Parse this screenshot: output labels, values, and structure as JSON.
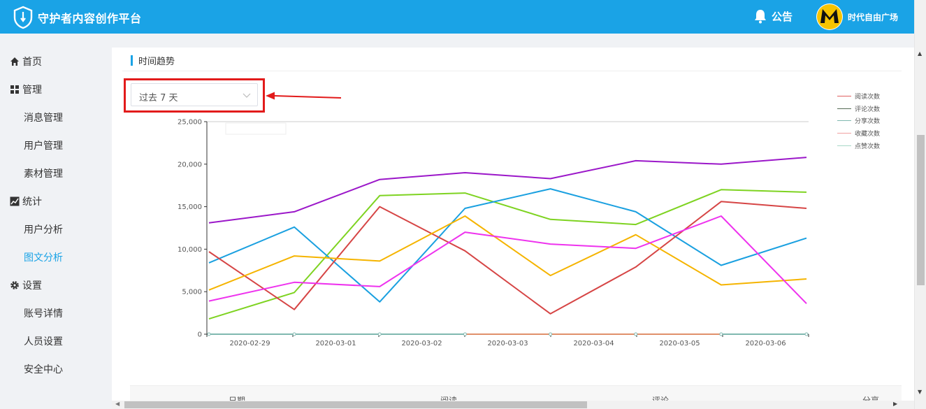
{
  "header": {
    "app_title": "守护者内容创作平台",
    "notice_label": "公告",
    "username": "时代自由广场",
    "bg_color": "#1aa3e6"
  },
  "sidebar": {
    "items": [
      {
        "label": "首页",
        "icon": "home-icon"
      },
      {
        "label": "管理",
        "icon": "grid-icon"
      },
      {
        "label": "消息管理"
      },
      {
        "label": "用户管理"
      },
      {
        "label": "素材管理"
      },
      {
        "label": "统计",
        "icon": "chart-icon"
      },
      {
        "label": "用户分析"
      },
      {
        "label": "图文分析",
        "active": true
      },
      {
        "label": "设置",
        "icon": "gear-icon"
      },
      {
        "label": "账号详情"
      },
      {
        "label": "人员设置"
      },
      {
        "label": "安全中心"
      }
    ]
  },
  "main": {
    "section_title": "时间趋势",
    "range_select": {
      "value": "过去 7 天"
    },
    "table_headers": [
      "日期",
      "阅读",
      "评论",
      "分享"
    ]
  },
  "chart_data": {
    "type": "line",
    "categories": [
      "2020-02-29",
      "2020-03-01",
      "2020-03-02",
      "2020-03-03",
      "2020-03-04",
      "2020-03-05",
      "2020-03-06"
    ],
    "y_ticks": [
      "0",
      "5,000",
      "10,000",
      "15,000",
      "20,000",
      "25,000"
    ],
    "ylim": [
      0,
      25000
    ],
    "legend": [
      {
        "name": "阅读次数",
        "color": "#e06060"
      },
      {
        "name": "评论次数",
        "color": "#556b55"
      },
      {
        "name": "分享次数",
        "color": "#7fb8b0"
      },
      {
        "name": "收藏次数",
        "color": "#f0a0a0"
      },
      {
        "name": "点赞次数",
        "color": "#a8d8c8"
      }
    ],
    "series": [
      {
        "color": "#9b17c9",
        "values": [
          13100,
          14400,
          18200,
          19000,
          18300,
          20400,
          20000,
          20800
        ]
      },
      {
        "color": "#7ed321",
        "values": [
          1800,
          4900,
          16300,
          16600,
          13500,
          12900,
          17000,
          16700
        ]
      },
      {
        "color": "#1aa0e0",
        "values": [
          8400,
          12600,
          3800,
          14800,
          17100,
          14400,
          8100,
          11300
        ]
      },
      {
        "color": "#d64545",
        "values": [
          9700,
          2900,
          15000,
          9800,
          2400,
          7900,
          15600,
          14800
        ]
      },
      {
        "color": "#f5b400",
        "values": [
          5200,
          9200,
          8600,
          13900,
          6900,
          11700,
          5800,
          6500
        ]
      },
      {
        "color": "#ee33ee",
        "values": [
          3900,
          6100,
          5600,
          12000,
          10600,
          10100,
          13900,
          3600
        ]
      },
      {
        "color": "#7fb8b0",
        "values": [
          0,
          0,
          0,
          0,
          0,
          0,
          0,
          0
        ]
      },
      {
        "color": "#e0906a",
        "values": [
          null,
          null,
          null,
          0,
          0,
          0,
          0,
          null
        ]
      }
    ]
  }
}
